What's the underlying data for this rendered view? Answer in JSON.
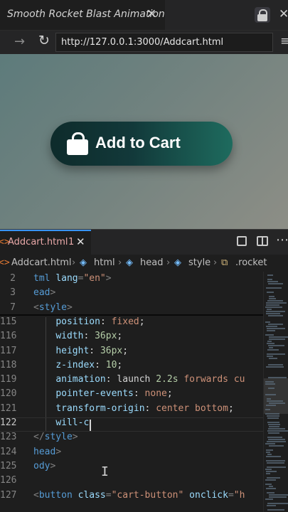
{
  "browser": {
    "tab_title": "Smooth Rocket Blast Animation",
    "tab_close": "✕",
    "url": "http://127.0.0.1:3000/Addcart.html",
    "back_icon": "arrow-right-icon",
    "reload": "↻",
    "forward": "→",
    "menu": "≡"
  },
  "preview": {
    "button_label": "Add to Cart",
    "icon": "shopping-bag-icon"
  },
  "editor": {
    "tab": {
      "icon": "<>",
      "name": "Addcart.html",
      "problems": "1",
      "close": "✕"
    },
    "more": "⋯",
    "breadcrumb": {
      "file_icon": "<>",
      "file": "Addcart.html",
      "items": [
        "html",
        "head",
        "style",
        ".rocket"
      ],
      "sep": "›"
    },
    "sticky": [
      {
        "n": "2",
        "parts": [
          [
            "t-tag",
            "tml "
          ],
          [
            "t-attr",
            "lang"
          ],
          [
            "t-punct",
            "="
          ],
          [
            "t-str",
            "\"en\""
          ],
          [
            "t-punct",
            ">"
          ]
        ]
      },
      {
        "n": "3",
        "parts": [
          [
            "t-tag",
            "ead"
          ],
          [
            "t-punct",
            ">"
          ]
        ]
      },
      {
        "n": "7",
        "parts": [
          [
            "t-punct",
            "<"
          ],
          [
            "t-tag",
            "style"
          ],
          [
            "t-punct",
            ">"
          ]
        ]
      }
    ],
    "lines": [
      {
        "n": "115",
        "parts": [
          [
            "t-plain",
            "    "
          ],
          [
            "t-prop",
            "position"
          ],
          [
            "t-plain",
            ": "
          ],
          [
            "t-val",
            "fixed"
          ],
          [
            "t-plain",
            ";"
          ]
        ]
      },
      {
        "n": "116",
        "parts": [
          [
            "t-plain",
            "    "
          ],
          [
            "t-prop",
            "width"
          ],
          [
            "t-plain",
            ": "
          ],
          [
            "t-num",
            "36px"
          ],
          [
            "t-plain",
            ";"
          ]
        ]
      },
      {
        "n": "117",
        "parts": [
          [
            "t-plain",
            "    "
          ],
          [
            "t-prop",
            "height"
          ],
          [
            "t-plain",
            ": "
          ],
          [
            "t-num",
            "36px"
          ],
          [
            "t-plain",
            ";"
          ]
        ]
      },
      {
        "n": "118",
        "parts": [
          [
            "t-plain",
            "    "
          ],
          [
            "t-prop",
            "z-index"
          ],
          [
            "t-plain",
            ": "
          ],
          [
            "t-num",
            "10"
          ],
          [
            "t-plain",
            ";"
          ]
        ]
      },
      {
        "n": "119",
        "parts": [
          [
            "t-plain",
            "    "
          ],
          [
            "t-prop",
            "animation"
          ],
          [
            "t-plain",
            ": launch "
          ],
          [
            "t-num",
            "2.2s"
          ],
          [
            "t-plain",
            " "
          ],
          [
            "t-val",
            "forwards"
          ],
          [
            "t-plain",
            " "
          ],
          [
            "t-val",
            "cu"
          ]
        ]
      },
      {
        "n": "120",
        "parts": [
          [
            "t-plain",
            "    "
          ],
          [
            "t-prop",
            "pointer-events"
          ],
          [
            "t-plain",
            ": "
          ],
          [
            "t-val",
            "none"
          ],
          [
            "t-plain",
            ";"
          ]
        ]
      },
      {
        "n": "121",
        "parts": [
          [
            "t-plain",
            "    "
          ],
          [
            "t-prop",
            "transform-origin"
          ],
          [
            "t-plain",
            ": "
          ],
          [
            "t-val",
            "center bottom"
          ],
          [
            "t-plain",
            ";"
          ]
        ]
      },
      {
        "n": "122",
        "parts": [
          [
            "t-plain",
            "    "
          ],
          [
            "t-prop",
            "will-c"
          ]
        ]
      },
      {
        "n": "123",
        "parts": [
          [
            "t-punct",
            "</"
          ],
          [
            "t-tag",
            "style"
          ],
          [
            "t-punct",
            ">"
          ]
        ]
      },
      {
        "n": "124",
        "parts": [
          [
            "t-tag",
            "head"
          ],
          [
            "t-punct",
            ">"
          ]
        ]
      },
      {
        "n": "125",
        "parts": [
          [
            "t-tag",
            "ody"
          ],
          [
            "t-punct",
            ">"
          ]
        ]
      },
      {
        "n": "126",
        "parts": []
      },
      {
        "n": "127",
        "parts": [
          [
            "t-punct",
            "<"
          ],
          [
            "t-tag",
            "button "
          ],
          [
            "t-attr",
            "class"
          ],
          [
            "t-punct",
            "="
          ],
          [
            "t-str",
            "\"cart-button\" "
          ],
          [
            "t-attr",
            "onclick"
          ],
          [
            "t-punct",
            "="
          ],
          [
            "t-str",
            "\"h"
          ]
        ]
      }
    ],
    "current_line": "122"
  }
}
